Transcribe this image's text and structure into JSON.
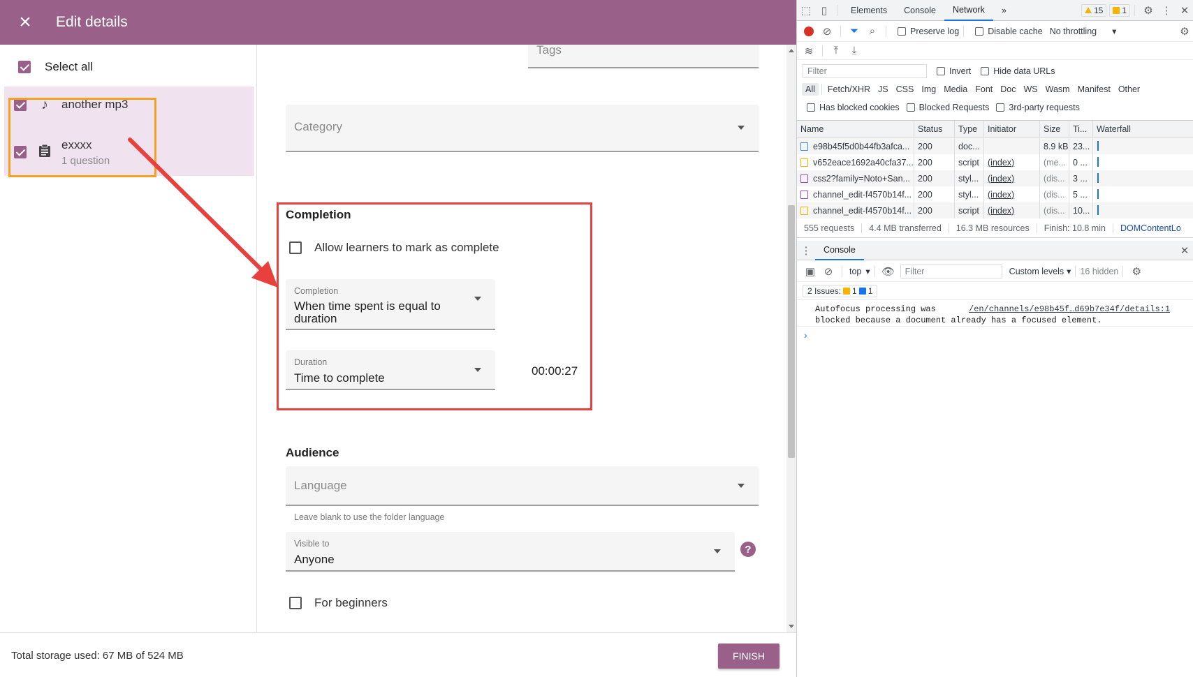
{
  "app": {
    "title": "Edit details",
    "close_icon": "×",
    "select_all": "Select all",
    "items": [
      {
        "name": "another mp3",
        "icon": "music-note-icon",
        "glyph": "♪",
        "subtitle": ""
      },
      {
        "name": "exxxx",
        "icon": "clipboard-icon",
        "glyph": "📋",
        "subtitle": "1 question"
      }
    ],
    "fields": {
      "tags_placeholder": "Tags",
      "category_placeholder": "Category"
    },
    "completion": {
      "title": "Completion",
      "allow_learners_label": "Allow learners to mark as complete",
      "completion_label": "Completion",
      "completion_value": "When time spent is equal to duration",
      "duration_label": "Duration",
      "duration_value": "Time to complete",
      "duration_time": "00:00:27"
    },
    "audience": {
      "title": "Audience",
      "language_placeholder": "Language",
      "language_hint": "Leave blank to use the folder language",
      "visible_to_label": "Visible to",
      "visible_to_value": "Anyone",
      "help_icon": "?",
      "for_beginners_label": "For beginners"
    },
    "footer": {
      "storage": "Total storage used: 67 MB of 524 MB",
      "finish_label": "FINISH"
    },
    "colors": {
      "brand": "#996189",
      "selected_bg": "#f1e2f0",
      "highlight_orange": "#f2a122",
      "highlight_red": "#e8403c"
    }
  },
  "devtools": {
    "tabs": [
      "Elements",
      "Console",
      "Network"
    ],
    "active_tab": "Network",
    "more": "»",
    "warnings_count": "15",
    "issues_count": "1",
    "toolbar": {
      "preserve_log": "Preserve log",
      "disable_cache": "Disable cache",
      "throttling": "No throttling"
    },
    "filter_placeholder": "Filter",
    "invert": "Invert",
    "hide_data_urls": "Hide data URLs",
    "types": [
      "All",
      "Fetch/XHR",
      "JS",
      "CSS",
      "Img",
      "Media",
      "Font",
      "Doc",
      "WS",
      "Wasm",
      "Manifest",
      "Other"
    ],
    "has_blocked_cookies": "Has blocked cookies",
    "blocked_requests": "Blocked Requests",
    "third_party": "3rd-party requests",
    "columns": [
      "Name",
      "Status",
      "Type",
      "Initiator",
      "Size",
      "Ti...",
      "Waterfall"
    ],
    "rows": [
      {
        "name": "e98b45f5d0b44fb3afca...",
        "status": "200",
        "type": "doc...",
        "initiator": "",
        "size": "8.9 kB",
        "time": "23...",
        "icon_color": "#4285f4"
      },
      {
        "name": "v652eace1692a40cfa37...",
        "status": "200",
        "type": "script",
        "initiator": "(index)",
        "size": "(me...",
        "time": "0 ...",
        "icon_color": "#f4b400"
      },
      {
        "name": "css2?family=Noto+San...",
        "status": "200",
        "type": "styl...",
        "initiator": "(index)",
        "size": "(dis...",
        "time": "3 ...",
        "icon_color": "#a142f4"
      },
      {
        "name": "channel_edit-f4570b14f...",
        "status": "200",
        "type": "styl...",
        "initiator": "(index)",
        "size": "(dis...",
        "time": "5 ...",
        "icon_color": "#a142f4"
      },
      {
        "name": "channel_edit-f4570b14f...",
        "status": "200",
        "type": "script",
        "initiator": "(index)",
        "size": "(dis...",
        "time": "10...",
        "icon_color": "#f4b400"
      }
    ],
    "summary": {
      "requests": "555 requests",
      "transferred": "4.4 MB transferred",
      "resources": "16.3 MB resources",
      "finish": "Finish: 10.8 min",
      "dom": "DOMContentLo"
    },
    "drawer": {
      "tab": "Console",
      "context": "top",
      "filter_placeholder": "Filter",
      "levels": "Custom levels",
      "hidden": "16 hidden",
      "issues_label": "2 Issues:",
      "issues_warn": "1",
      "issues_info": "1",
      "message_line1": "Autofocus processing was",
      "message_line2": "blocked because a document already has a focused element.",
      "message_source": "/en/channels/e98b45f…d69b7e34f/details:1",
      "prompt": "›"
    }
  }
}
